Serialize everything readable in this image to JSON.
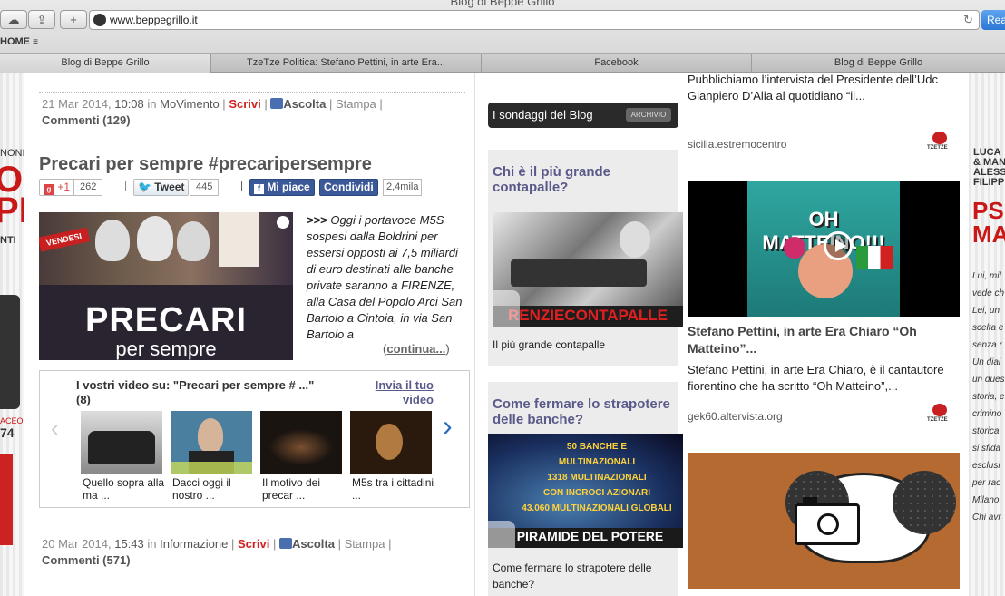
{
  "browser": {
    "window_title": "Blog di Beppe Grillo",
    "url": "www.beppegrillo.it",
    "reader_label": "Rea",
    "bookmark": "HOME",
    "tabs": [
      {
        "label": "Blog di Beppe Grillo"
      },
      {
        "label": "TzeTze Politica: Stefano Pettini, in arte Era..."
      },
      {
        "label": "Facebook"
      },
      {
        "label": "Blog di Beppe Grillo"
      }
    ]
  },
  "post1": {
    "date": "21 Mar 2014,",
    "time": "10:08",
    "in": "in",
    "category": "MoVimento",
    "sep": "|",
    "write": "Scrivi",
    "listen": "Ascolta",
    "print": "Stampa",
    "comments": "Commenti (129)",
    "title": "Precari per sempre #precaripersempre",
    "gplus_label": "+1",
    "gplus_count": "262",
    "tweet_label": "Tweet",
    "tweet_count": "445",
    "fb_like": "Mi piace",
    "fb_share": "Condividi",
    "fb_count": "2,4mila",
    "image_title_1": "PRECARI",
    "image_title_2": "per sempre",
    "image_sign_1": "VENDESI",
    "lead": ">>>",
    "excerpt": "Oggi i portavoce M5S sospesi dalla Boldrini per essersi opposti ai 7,5 miliardi di euro destinati alle banche private saranno a FIRENZE, alla Casa del Popolo Arci San Bartolo a Cintoia, in via San Bartolo a",
    "continue": "continua...",
    "videos_title": "I vostri video su: \"Precari per sempre # ...\" (8)",
    "send_video": "Invia il tuo video",
    "videos": [
      {
        "caption": "Quello sopra alla ma ..."
      },
      {
        "caption": "Dacci oggi il nostro ..."
      },
      {
        "caption": "Il motivo dei precar ..."
      },
      {
        "caption": "M5s tra i cittadini ..."
      }
    ]
  },
  "post2": {
    "date": "20 Mar 2014,",
    "time": "15:43",
    "in": "in",
    "category": "Informazione",
    "write": "Scrivi",
    "listen": "Ascolta",
    "print": "Stampa",
    "comments": "Commenti (571)"
  },
  "polls": {
    "header": "I sondaggi del Blog",
    "archive": "ARCHIVIO",
    "items": [
      {
        "question": "Chi è il più grande contapalle?",
        "banner": "RENZIECONTAPALLE",
        "caption": "Il più grande contapalle"
      },
      {
        "question": "Come fermare lo strapotere delle banche?",
        "banner": "PIRAMIDE DEL POTERE",
        "caption": "Come fermare lo strapotere delle banche?",
        "lines": [
          "50 BANCHE E",
          "MULTINAZIONALI",
          "1318 MULTINAZIONALI",
          "CON INCROCI AZIONARI",
          "43.060 MULTINAZIONALI GLOBALI"
        ]
      }
    ]
  },
  "tzetze": {
    "logo_text": "TZETZE",
    "item0": {
      "text": "Pubblichiamo l’intervista del Presidente dell’Udc Gianpiero D’Alia al quotidiano “il...",
      "source": "sicilia.estremocentro"
    },
    "item1": {
      "video_title": "OH MATTEINO!!!",
      "title": "Stefano Pettini, in arte Era Chiaro “Oh Matteino”...",
      "text": "Stefano Pettini, in arte Era Chiaro, è il cantautore fiorentino che ha scritto “Oh Matteino”,...",
      "source": "gek60.altervista.org"
    }
  },
  "left_ad": {
    "line1": "NONI",
    "line2": "O",
    "line3": "PE",
    "line4": "NTI",
    "line5": "ACEO",
    "line6": "74"
  },
  "right_ad": {
    "names": [
      "LUCA",
      "& MAN",
      "ALESS",
      "FILIPP"
    ],
    "big": [
      "PS",
      "MA"
    ],
    "lines": [
      "Lui, mil",
      "vede ch",
      "Lei, un",
      "scelta e",
      "senza r",
      "Un dial",
      "un dues",
      "storia, e",
      "crimino",
      "storica",
      "si sfida",
      "esclusi",
      "per rac",
      "Milano.",
      "Chi avr"
    ]
  }
}
